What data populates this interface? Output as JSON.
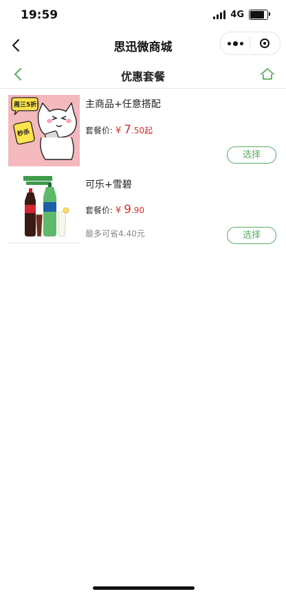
{
  "status_bar": {
    "time": "19:59",
    "network": "4G",
    "battery_level": 0.85
  },
  "nav": {
    "title": "思迅微商城",
    "more_icon": "more-dots-icon",
    "close_icon": "target-circle-icon"
  },
  "page": {
    "title": "优惠套餐",
    "back_icon": "chevron-left-icon",
    "home_icon": "home-outline-icon"
  },
  "colors": {
    "accent": "#5aab63",
    "price": "#d2302c",
    "muted": "#888888"
  },
  "packages": [
    {
      "name": "主商品+任意搭配",
      "price_label": "套餐价:",
      "currency": "¥",
      "price_int": "7",
      "price_dec": ".50起",
      "savings": "",
      "select_label": "选择",
      "image_text": "周三5折!",
      "image_badge": "秒杀"
    },
    {
      "name": "可乐+雪碧",
      "price_label": "套餐价:",
      "currency": "¥",
      "price_int": "9",
      "price_dec": ".90",
      "savings": "最多可省4.40元",
      "select_label": "选择",
      "image_text": "",
      "image_badge": ""
    }
  ]
}
